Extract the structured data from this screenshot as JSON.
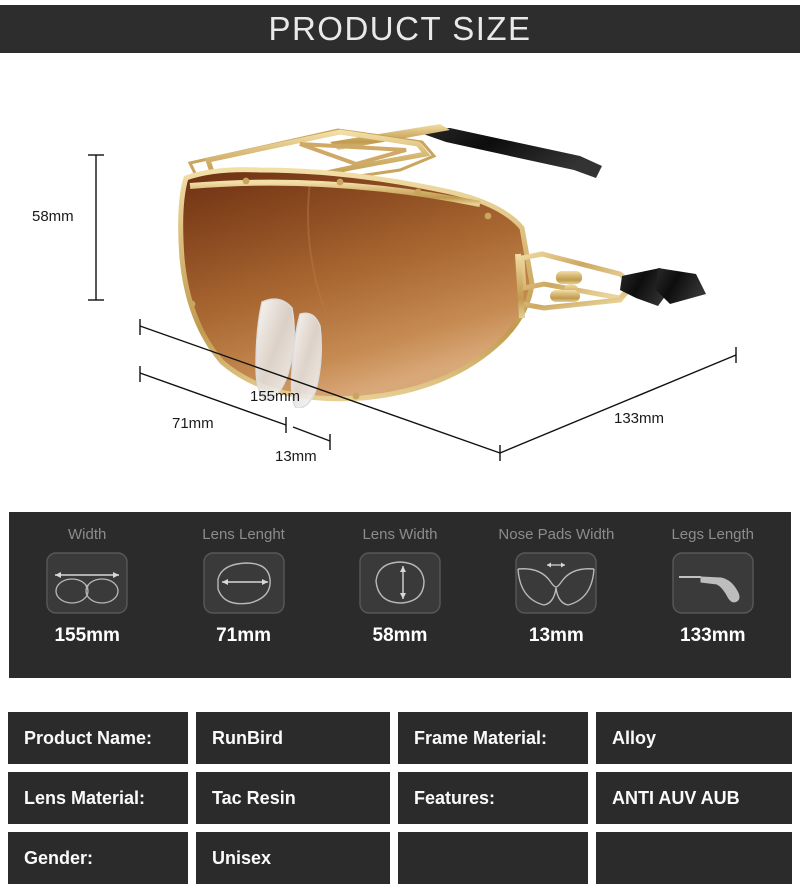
{
  "header": {
    "title": "PRODUCT SIZE"
  },
  "diagram": {
    "product_alt": "gold-frame-brown-gradient-shield-sunglasses",
    "dimension_labels": {
      "height": "58mm",
      "total_width": "155mm",
      "lens_length": "71mm",
      "nose_pads": "13mm",
      "legs_length": "133mm"
    }
  },
  "measurements": [
    {
      "label": "Width",
      "value": "155mm",
      "icon": "glasses-front-width-icon"
    },
    {
      "label": "Lens Lenght",
      "value": "71mm",
      "icon": "lens-horizontal-icon"
    },
    {
      "label": "Lens Width",
      "value": "58mm",
      "icon": "lens-vertical-icon"
    },
    {
      "label": "Nose Pads Width",
      "value": "13mm",
      "icon": "nose-bridge-icon"
    },
    {
      "label": "Legs Length",
      "value": "133mm",
      "icon": "temple-arm-icon"
    }
  ],
  "specs": [
    {
      "key1": "Product Name:",
      "val1": "RunBird",
      "key2": "Frame Material:",
      "val2": "Alloy"
    },
    {
      "key1": "Lens Material:",
      "val1": "Tac Resin",
      "key2": "Features:",
      "val2": "ANTI AUV AUB"
    },
    {
      "key1": "Gender:",
      "val1": "Unisex",
      "key2": "",
      "val2": ""
    }
  ],
  "colors": {
    "panel_dark": "#2b2b2b",
    "header_dark": "#2d2d2d",
    "label_gray": "#8c8c8c",
    "value_white": "#ffffff",
    "frame_gold": "#d4af6a",
    "lens_brown": "#8a4a22",
    "temple_black": "#171717"
  }
}
